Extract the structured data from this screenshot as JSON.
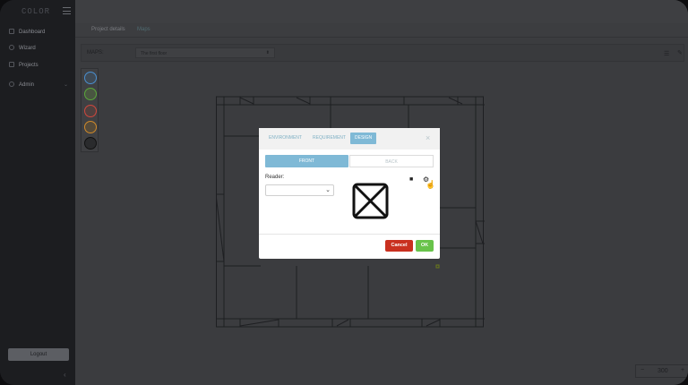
{
  "app": {
    "logo_text": "COLOR"
  },
  "sidebar": {
    "items": [
      {
        "label": "Dashboard",
        "icon": "dashboard-icon"
      },
      {
        "label": "Wizard",
        "icon": "wizard-icon"
      },
      {
        "label": "Projects",
        "icon": "projects-icon"
      },
      {
        "label": "Admin",
        "icon": "admin-icon",
        "has_submenu": true
      }
    ],
    "logout_label": "Logout"
  },
  "main": {
    "tabs": [
      {
        "label": "Project details"
      },
      {
        "label": "Maps"
      }
    ],
    "maps_label": "MAPS:",
    "maps_selected": "The first floor",
    "zoom_value": "300",
    "tool_colors": [
      "#4a8fd0",
      "#5aa83a",
      "#d0473d",
      "#d08a2a",
      "#222222"
    ]
  },
  "modal": {
    "tabs": [
      {
        "label": "ENVIRONMENT"
      },
      {
        "label": "REQUIREMENT"
      },
      {
        "label": "DESIGN",
        "active": true
      }
    ],
    "toggle_front": "FRONT",
    "toggle_back": "BACK",
    "reader_label": "Reader:",
    "reader_value": "",
    "cancel_label": "Cancel",
    "ok_label": "OK"
  },
  "colors": {
    "accent": "#7fb9d6",
    "cancel": "#c9301f",
    "ok": "#68c34a"
  }
}
